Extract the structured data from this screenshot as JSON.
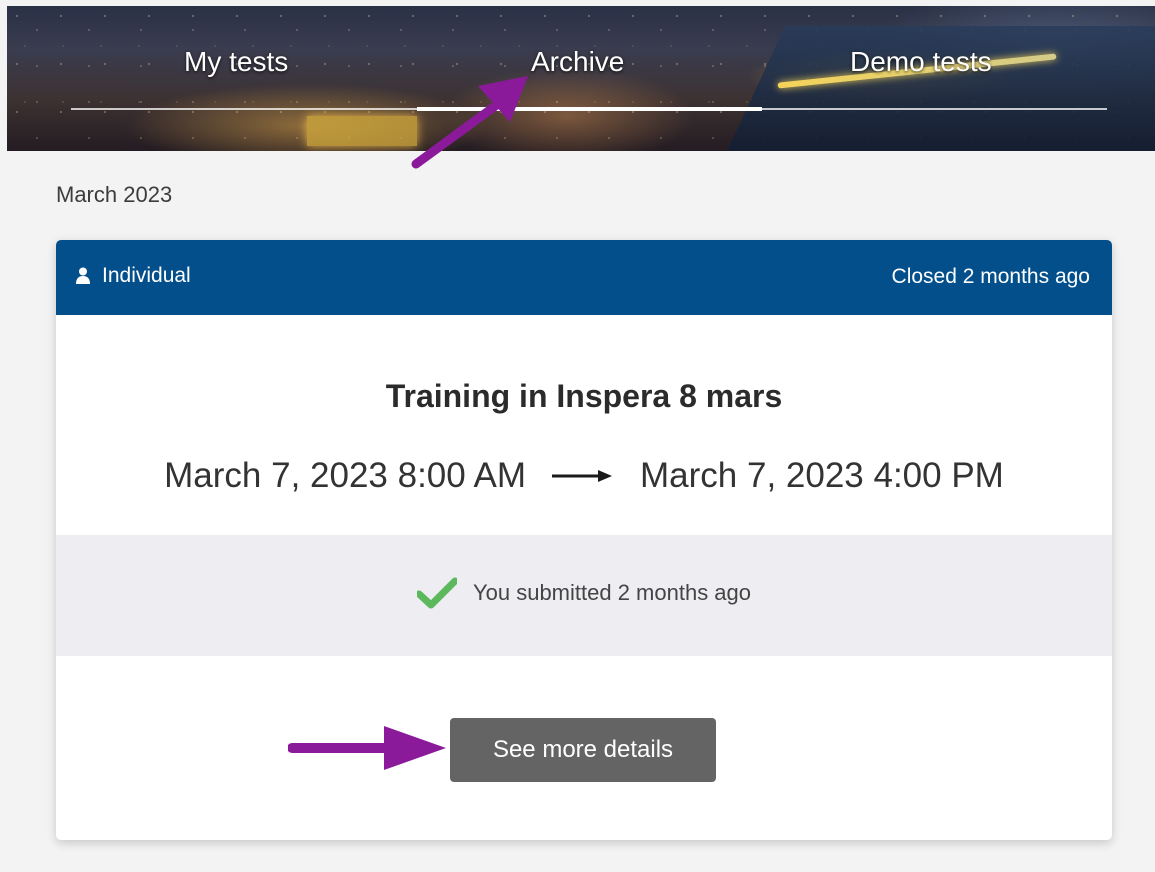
{
  "tabs": [
    {
      "label": "My tests",
      "active": false
    },
    {
      "label": "Archive",
      "active": true
    },
    {
      "label": "Demo tests",
      "active": false
    }
  ],
  "month_label": "March 2023",
  "card": {
    "type_icon": "person-icon",
    "type_label": "Individual",
    "status": "Closed 2 months ago",
    "title": "Training in Inspera 8 mars",
    "start": "March 7, 2023 8:00 AM",
    "end": "March 7, 2023 4:00 PM",
    "submitted_icon": "checkmark-icon",
    "submitted_text": "You submitted 2 months ago",
    "details_button": "See more details"
  },
  "colors": {
    "header_blue": "#024f8c",
    "check_green": "#5cb85c",
    "button_gray": "#646464",
    "annotation_purple": "#8b1a9b"
  }
}
